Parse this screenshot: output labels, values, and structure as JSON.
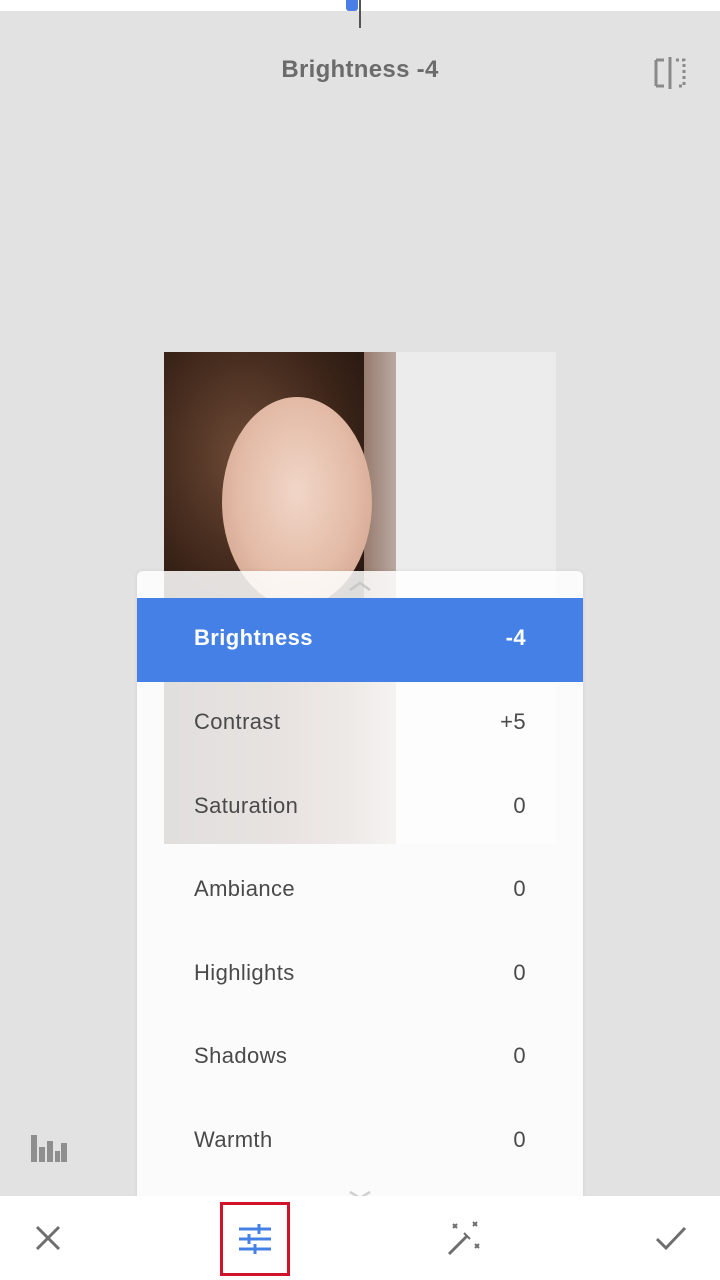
{
  "header": {
    "title": "Brightness -4"
  },
  "colors": {
    "accent": "#4580e6",
    "highlight_box": "#d0122a",
    "background": "#e2e2e2"
  },
  "icons": {
    "compare": "compare-icon",
    "histogram": "histogram-icon",
    "cancel": "close-icon",
    "tune": "sliders-icon",
    "auto": "magic-wand-icon",
    "apply": "checkmark-icon"
  },
  "adjustments": [
    {
      "label": "Brightness",
      "value": "-4",
      "active": true
    },
    {
      "label": "Contrast",
      "value": "+5",
      "active": false
    },
    {
      "label": "Saturation",
      "value": "0",
      "active": false
    },
    {
      "label": "Ambiance",
      "value": "0",
      "active": false
    },
    {
      "label": "Highlights",
      "value": "0",
      "active": false
    },
    {
      "label": "Shadows",
      "value": "0",
      "active": false
    },
    {
      "label": "Warmth",
      "value": "0",
      "active": false
    }
  ]
}
